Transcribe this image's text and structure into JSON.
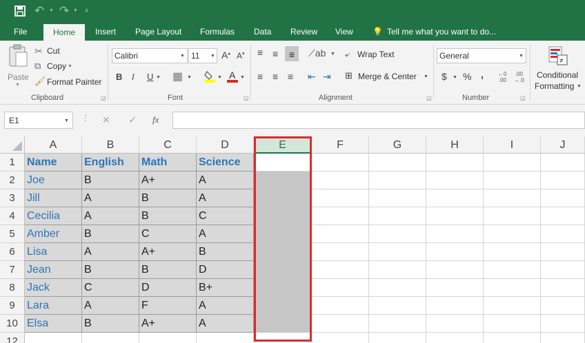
{
  "qat": {
    "save_icon": "save-icon",
    "undo_icon": "undo-icon",
    "redo_icon": "redo-icon",
    "customize_icon": "customize-qat-icon"
  },
  "tabs": [
    {
      "label": "File"
    },
    {
      "label": "Home"
    },
    {
      "label": "Insert"
    },
    {
      "label": "Page Layout"
    },
    {
      "label": "Formulas"
    },
    {
      "label": "Data"
    },
    {
      "label": "Review"
    },
    {
      "label": "View"
    }
  ],
  "tell_me": "Tell me what you want to do...",
  "ribbon": {
    "clipboard": {
      "label": "Clipboard",
      "paste": "Paste",
      "cut": "Cut",
      "copy": "Copy",
      "format_painter": "Format Painter"
    },
    "font": {
      "label": "Font",
      "name": "Calibri",
      "size": "11",
      "bold": "B",
      "italic": "I",
      "underline": "U"
    },
    "alignment": {
      "label": "Alignment",
      "wrap_text": "Wrap Text",
      "merge_center": "Merge & Center"
    },
    "number": {
      "label": "Number",
      "format": "General",
      "currency": "$",
      "percent": "%",
      "comma": ","
    },
    "styles": {
      "conditional_formatting": [
        "Conditional",
        "Formatting"
      ]
    }
  },
  "formula_bar": {
    "name_box": "E1",
    "cancel": "✕",
    "enter": "✓",
    "fx": "fx",
    "content": ""
  },
  "columns": [
    "A",
    "B",
    "C",
    "D",
    "E",
    "F",
    "G",
    "H",
    "I",
    "J"
  ],
  "selected_column": "E",
  "rows": [
    "1",
    "2",
    "3",
    "4",
    "5",
    "6",
    "7",
    "8",
    "9",
    "10",
    "12"
  ],
  "table": {
    "headers": [
      "Name",
      "English",
      "Math",
      "Science"
    ],
    "rows": [
      [
        "Joe",
        "B",
        "A+",
        "A"
      ],
      [
        "Jill",
        "A",
        "B",
        "A"
      ],
      [
        "Cecilia",
        "A",
        "B",
        "C"
      ],
      [
        "Amber",
        "B",
        "C",
        "A"
      ],
      [
        "Lisa",
        "A",
        "A+",
        "B"
      ],
      [
        "Jean",
        "B",
        "B",
        "D"
      ],
      [
        "Jack",
        "C",
        "D",
        "B+"
      ],
      [
        "Lara",
        "A",
        "F",
        "A"
      ],
      [
        "Elsa",
        "B",
        "A+",
        "A"
      ]
    ]
  },
  "colors": {
    "excel_green": "#217346",
    "header_text": "#2e75b6",
    "selection_border": "#e0282e",
    "data_fill": "#d9d9d9",
    "selection_fill": "#c6c6c6"
  }
}
